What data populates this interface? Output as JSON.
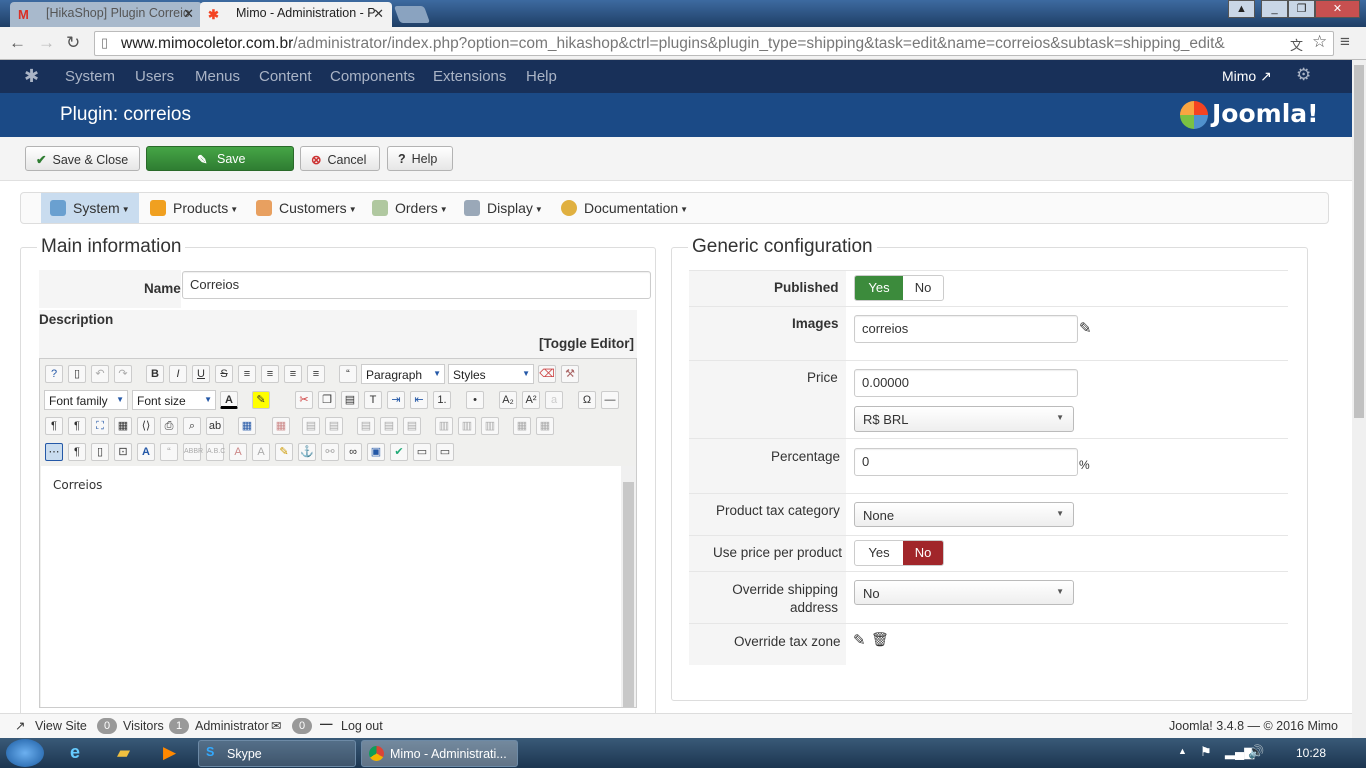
{
  "browser": {
    "tabs": [
      {
        "label": "[HikaShop] Plugin Correio",
        "icon": "gmail-icon"
      },
      {
        "label": "Mimo - Administration - P",
        "icon": "joomla-icon"
      }
    ],
    "url_host": "www.mimocoletor.com.br",
    "url_path": "/administrator/index.php?option=com_hikashop&ctrl=plugins&plugin_type=shipping&task=edit&name=correios&subtask=shipping_edit&"
  },
  "joomla_nav": {
    "items": [
      "System",
      "Users",
      "Menus",
      "Content",
      "Components",
      "Extensions",
      "Help"
    ],
    "user": "Mimo"
  },
  "header": {
    "title": "Plugin: correios",
    "logo_text": "Joomla!"
  },
  "toolbar": {
    "save_close": "Save & Close",
    "save": "Save",
    "cancel": "Cancel",
    "help": "Help"
  },
  "hikamenu": [
    "System",
    "Products",
    "Customers",
    "Orders",
    "Display",
    "Documentation"
  ],
  "main_info": {
    "legend": "Main information",
    "name_label": "Name",
    "name_value": "Correios",
    "description_label": "Description",
    "toggle_editor": "[Toggle Editor]",
    "editor": {
      "paragraph": "Paragraph",
      "styles": "Styles",
      "font_family": "Font family",
      "font_size": "Font size",
      "content": "Correios"
    }
  },
  "generic": {
    "legend": "Generic configuration",
    "published_label": "Published",
    "yes": "Yes",
    "no": "No",
    "images_label": "Images",
    "images_value": "correios",
    "price_label": "Price",
    "price_value": "0.00000",
    "currency": "R$ BRL",
    "percentage_label": "Percentage",
    "percentage_value": "0",
    "percent_sign": "%",
    "tax_label": "Product tax category",
    "tax_value": "None",
    "price_per_product_label": "Use price per product",
    "override_shipping_label": "Override shipping address",
    "override_shipping_value": "No",
    "override_tax_label": "Override tax zone"
  },
  "statusbar": {
    "view_site": "View Site",
    "visitors_count": "0",
    "visitors": "Visitors",
    "admin_count": "1",
    "admin": "Administrator",
    "messages_count": "0",
    "logout": "Log out",
    "version": "Joomla! 3.4.8 — © 2016 Mimo"
  },
  "taskbar": {
    "items": [
      "Skype",
      "Mimo - Administrati..."
    ],
    "time": "10:28"
  },
  "colors": {
    "joomla_dark": "#183059",
    "joomla_header": "#1b4a86",
    "save_green": "#3c8b3c",
    "no_red": "#a1262a"
  }
}
